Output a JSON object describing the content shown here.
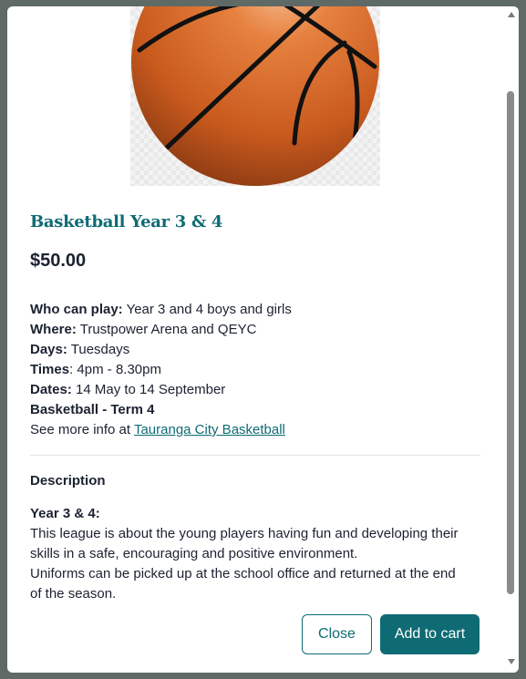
{
  "product": {
    "image_name": "basketball-image",
    "title": "Basketball Year 3 & 4",
    "price": "$50.00"
  },
  "info": {
    "who_label": "Who can play:",
    "who_value": " Year 3 and 4 boys and girls",
    "where_label": "Where:",
    "where_value": " Trustpower Arena and QEYC",
    "days_label": "Days:",
    "days_value": " Tuesdays",
    "times_label": "Times",
    "times_value": ": 4pm - 8.30pm",
    "dates_label": "Dates:",
    "dates_value": " 14 May to 14 September",
    "term_label": "Basketball - Term 4",
    "see_more_text": "See more info at ",
    "see_more_link": "Tauranga City Basketball"
  },
  "description": {
    "heading": "Description",
    "subheading": "Year 3 & 4:",
    "line1": "This league is about the young players having fun and developing their",
    "line2": "skills in a safe, encouraging and positive environment.",
    "line3": "Uniforms can be picked up at the school office and returned at the end",
    "line4": "of the season."
  },
  "footer": {
    "close_label": "Close",
    "add_to_cart_label": "Add to cart"
  },
  "colors": {
    "accent": "#0e6b74",
    "text": "#1b2230",
    "overlay": "#5f6a66"
  }
}
